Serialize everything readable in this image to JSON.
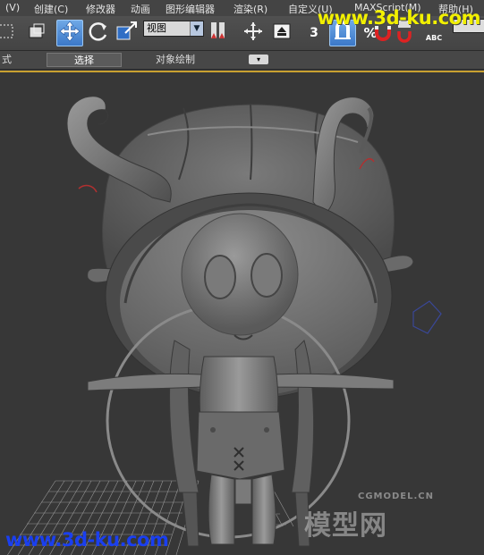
{
  "menu": [
    {
      "label": "(V)"
    },
    {
      "label": "创建(C)"
    },
    {
      "label": "修改器"
    },
    {
      "label": "动画"
    },
    {
      "label": "图形编辑器"
    },
    {
      "label": "渲染(R)"
    },
    {
      "label": "自定义(U)"
    },
    {
      "label": "MAXScript(M)"
    },
    {
      "label": "帮助(H)"
    }
  ],
  "toolbar": {
    "view_dropdown": "视图",
    "snap_number": "3",
    "percent_symbol": "%",
    "abc_label": "ABC"
  },
  "ribbon": {
    "left_label": "式",
    "tabs": [
      {
        "label": "选择"
      },
      {
        "label": "对象绘制"
      }
    ],
    "dropdown_symbol": "▾"
  },
  "watermark": {
    "top": "www.3d-ku.com",
    "bottom": "www.3d-ku.com",
    "cg_small": "CGMODEL.CN",
    "cg_big": "模型网"
  },
  "colors": {
    "menubar": "#444444",
    "viewport": "#373737",
    "active_button": "#3b78c8",
    "viewport_border": "#c9a030",
    "watermark_top": "#f2f000",
    "watermark_bottom": "#1a3ff0"
  }
}
